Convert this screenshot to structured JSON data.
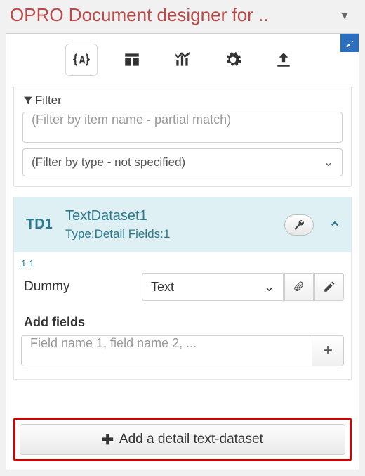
{
  "title": "OPRO Document designer for ..",
  "filter": {
    "label": "Filter",
    "name_placeholder": "(Filter by item name - partial match)",
    "type_placeholder": "(Filter by type - not specified)"
  },
  "dataset": {
    "id": "TD1",
    "name": "TextDataset1",
    "meta": "Type:Detail  Fields:1"
  },
  "field": {
    "index": "1-1",
    "name": "Dummy",
    "type": "Text"
  },
  "add_fields": {
    "label": "Add fields",
    "placeholder": "Field name 1, field name 2, ..."
  },
  "add_dataset_label": "Add a detail text-dataset"
}
